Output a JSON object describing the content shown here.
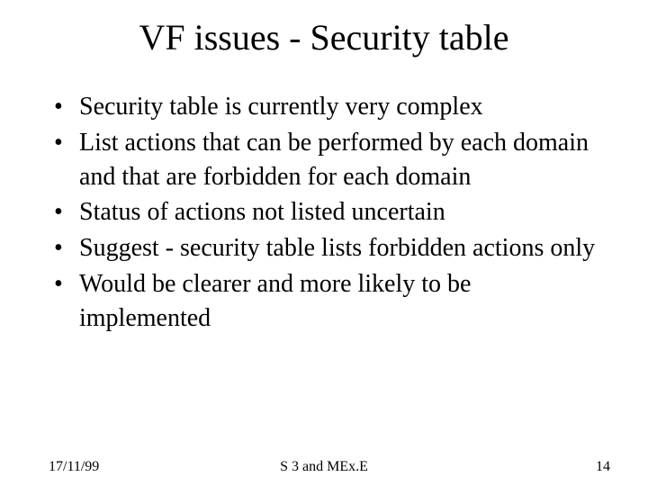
{
  "title": "VF issues - Security table",
  "bullets": [
    "Security table is currently very complex",
    "List actions that can be performed by each domain and that are forbidden for each domain",
    "Status of actions not listed uncertain",
    "Suggest - security table lists forbidden actions only",
    "Would be clearer and more likely to be implemented"
  ],
  "footer": {
    "date": "17/11/99",
    "center": "S 3 and MEx.E",
    "page": "14"
  }
}
